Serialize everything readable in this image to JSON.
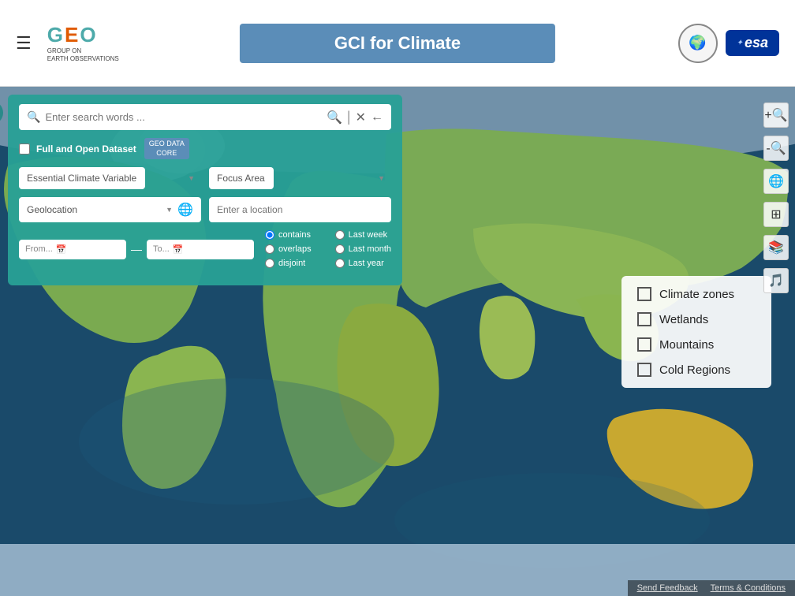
{
  "header": {
    "hamburger_label": "☰",
    "title": "GCI for Climate",
    "geo_logo_text": "GEO",
    "geo_logo_sub": "GROUP ON\nEARTH OBSERVATIONS",
    "logo_right1": "CEOS",
    "logo_esa": "esa"
  },
  "search_panel": {
    "search_placeholder": "Enter search words ...",
    "full_open_label": "Full and Open Dataset",
    "geo_data_badge": "GEO DATA\nCORE",
    "ecv_placeholder": "Essential Climate Variable",
    "focus_area_placeholder": "Focus Area",
    "geolocation_label": "Geolocation",
    "location_placeholder": "Enter a location",
    "from_label": "From...",
    "to_label": "To...",
    "radio_contains": "contains",
    "radio_overlaps": "overlaps",
    "radio_disjoint": "disjoint",
    "radio_last_week": "Last week",
    "radio_last_month": "Last month",
    "radio_last_year": "Last year"
  },
  "right_panel": {
    "items": [
      {
        "label": "Climate zones",
        "checked": false
      },
      {
        "label": "Wetlands",
        "checked": false
      },
      {
        "label": "Mountains",
        "checked": false
      },
      {
        "label": "Cold Regions",
        "checked": false
      }
    ]
  },
  "toolbar": {
    "buttons": [
      "🔍",
      "🔎",
      "🌐",
      "⊞",
      "📚",
      "🎵"
    ]
  },
  "footer": {
    "send_feedback": "Send Feedback",
    "terms": "Terms & Conditions"
  }
}
